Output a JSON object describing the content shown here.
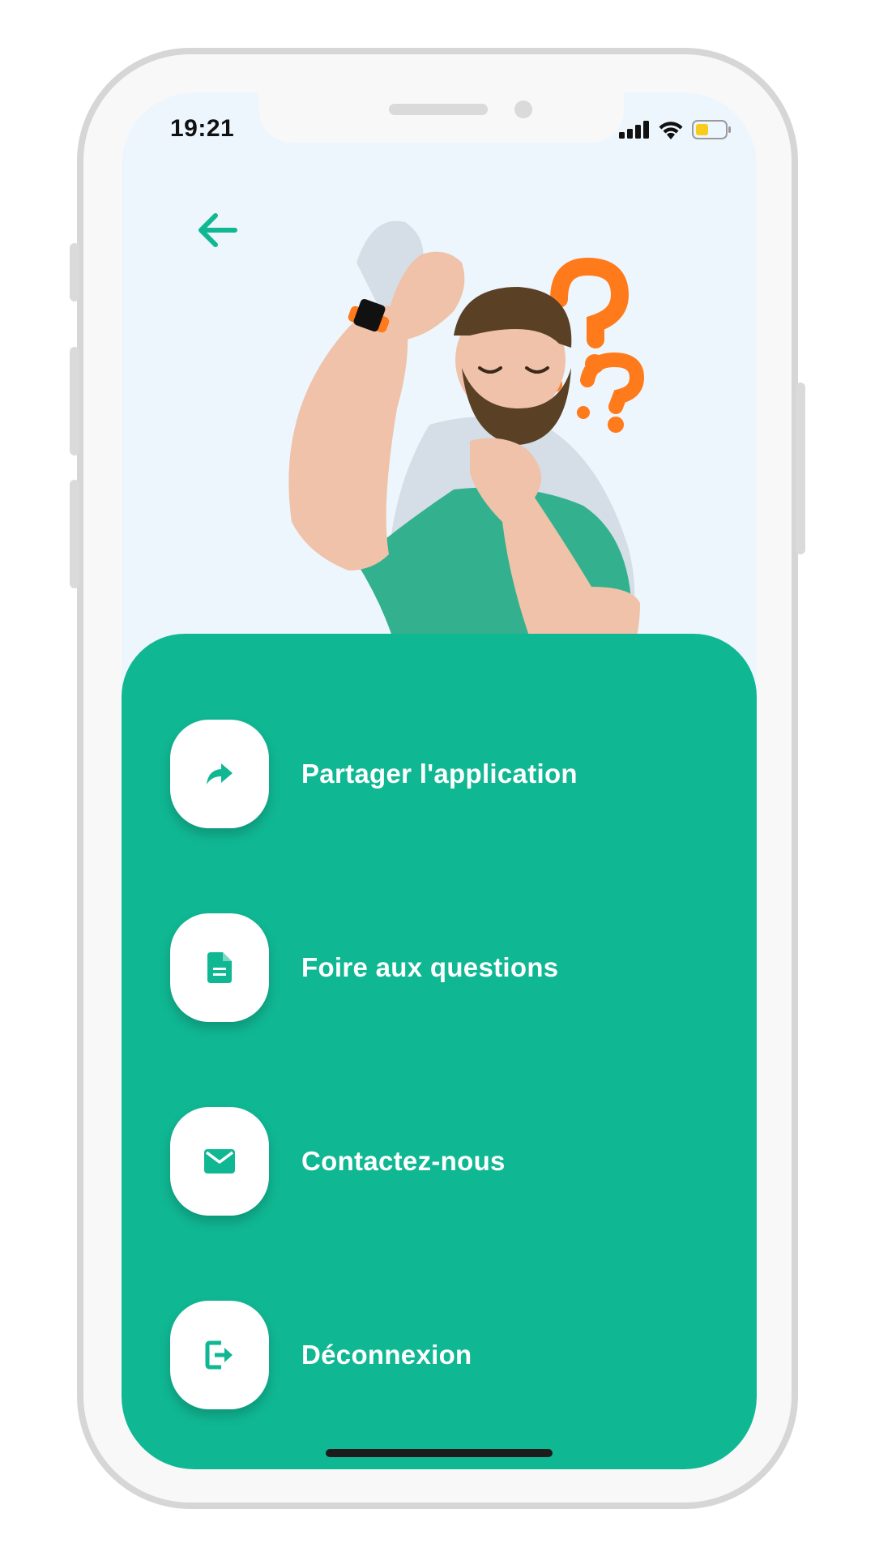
{
  "status_bar": {
    "time": "19:21",
    "icons": [
      "signal-icon",
      "wifi-icon",
      "battery-icon"
    ],
    "battery_color": "#f6cd1a"
  },
  "header": {
    "back_icon": "arrow-left-icon"
  },
  "colors": {
    "accent": "#10b793",
    "screen_background": "#eef6fd",
    "icon_tint": "#10b793"
  },
  "menu": {
    "items": [
      {
        "label": "Partager l'application",
        "icon": "share-icon"
      },
      {
        "label": "Foire aux questions",
        "icon": "document-icon"
      },
      {
        "label": "Contactez-nous",
        "icon": "mail-icon"
      },
      {
        "label": "Déconnexion",
        "icon": "logout-icon"
      }
    ]
  }
}
